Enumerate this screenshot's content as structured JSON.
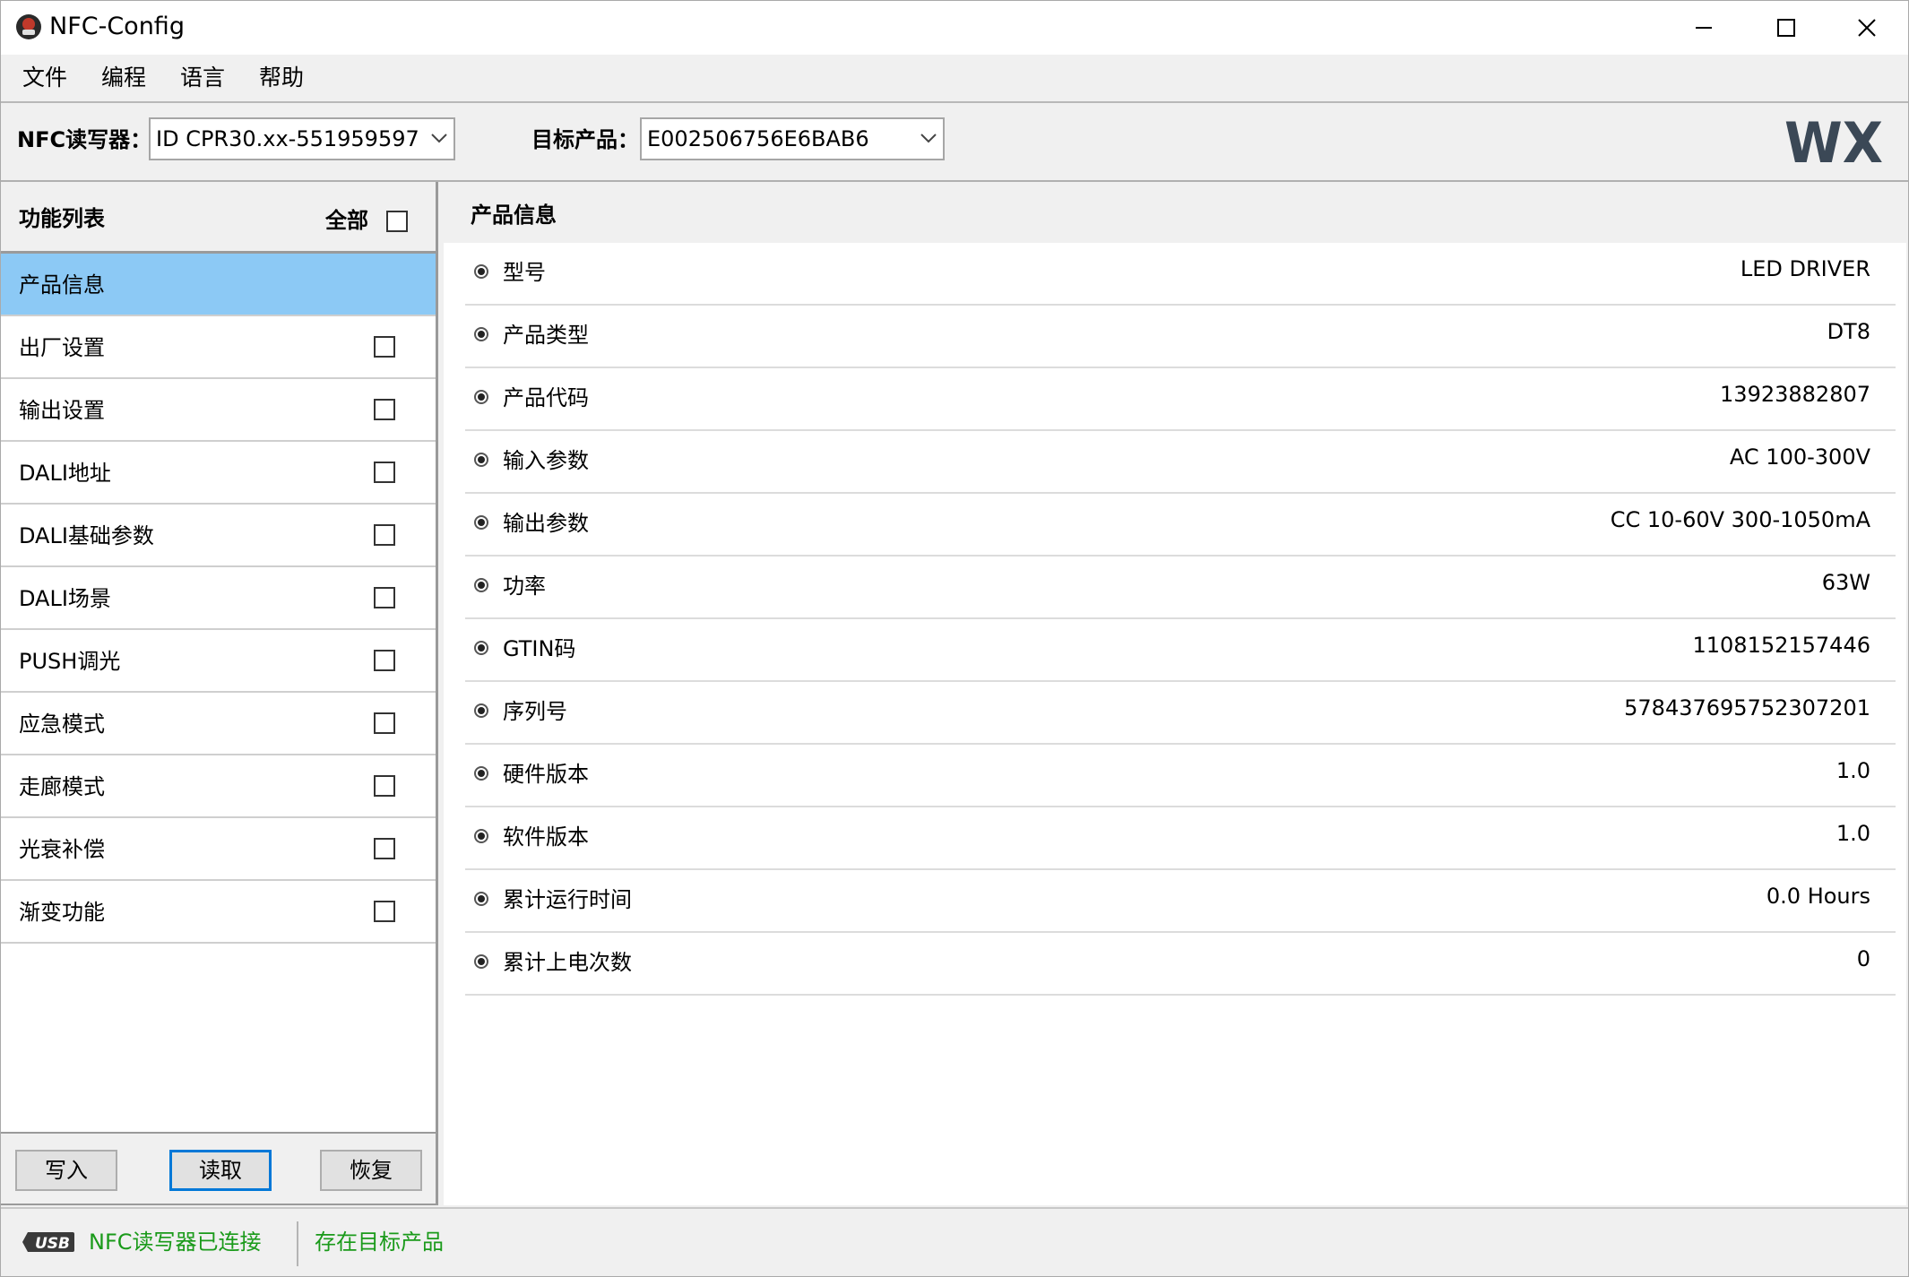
{
  "window": {
    "title": "NFC-Config",
    "controls": [
      "minimize-icon",
      "maximize-icon",
      "close-icon"
    ]
  },
  "menu": {
    "items": [
      {
        "label": "文件"
      },
      {
        "label": "编程"
      },
      {
        "label": "语言"
      },
      {
        "label": "帮助"
      }
    ]
  },
  "toolbar": {
    "reader_label": "NFC读写器：",
    "reader_value": "ID CPR30.xx-551959597",
    "target_label": "目标产品：",
    "target_value": "E002506756E6BAB6",
    "logo_text": "WX"
  },
  "features": {
    "title": "功能列表",
    "all_label": "全部",
    "all_checked": false,
    "items": [
      {
        "label": "产品信息",
        "selected": true,
        "has_checkbox": false,
        "checked": false
      },
      {
        "label": "出厂设置",
        "selected": false,
        "has_checkbox": true,
        "checked": false
      },
      {
        "label": "输出设置",
        "selected": false,
        "has_checkbox": true,
        "checked": false
      },
      {
        "label": "DALI地址",
        "selected": false,
        "has_checkbox": true,
        "checked": false
      },
      {
        "label": "DALI基础参数",
        "selected": false,
        "has_checkbox": true,
        "checked": false
      },
      {
        "label": "DALI场景",
        "selected": false,
        "has_checkbox": true,
        "checked": false
      },
      {
        "label": "PUSH调光",
        "selected": false,
        "has_checkbox": true,
        "checked": false
      },
      {
        "label": "应急模式",
        "selected": false,
        "has_checkbox": true,
        "checked": false
      },
      {
        "label": "走廊模式",
        "selected": false,
        "has_checkbox": true,
        "checked": false
      },
      {
        "label": "光衰补偿",
        "selected": false,
        "has_checkbox": true,
        "checked": false
      },
      {
        "label": "渐变功能",
        "selected": false,
        "has_checkbox": true,
        "checked": false
      }
    ],
    "buttons": {
      "write": "写入",
      "read": "读取",
      "restore": "恢复"
    }
  },
  "product_info": {
    "title": "产品信息",
    "rows": [
      {
        "label": "型号",
        "value": "LED DRIVER"
      },
      {
        "label": "产品类型",
        "value": "DT8"
      },
      {
        "label": "产品代码",
        "value": "13923882807"
      },
      {
        "label": "输入参数",
        "value": "AC 100-300V"
      },
      {
        "label": "输出参数",
        "value": "CC 10-60V 300-1050mA"
      },
      {
        "label": "功率",
        "value": "63W"
      },
      {
        "label": "GTIN码",
        "value": "1108152157446"
      },
      {
        "label": "序列号",
        "value": "578437695752307201"
      },
      {
        "label": "硬件版本",
        "value": "1.0"
      },
      {
        "label": "软件版本",
        "value": "1.0"
      },
      {
        "label": "累计运行时间",
        "value": "0.0 Hours"
      },
      {
        "label": "累计上电次数",
        "value": "0"
      }
    ]
  },
  "status": {
    "usb_icon": "usb-icon",
    "reader_status": "NFC读写器已连接",
    "target_status": "存在目标产品",
    "status_color": "#1a9a1a"
  },
  "colors": {
    "selected_row": "#8cc9f5",
    "default_button_border": "#0078d7"
  }
}
